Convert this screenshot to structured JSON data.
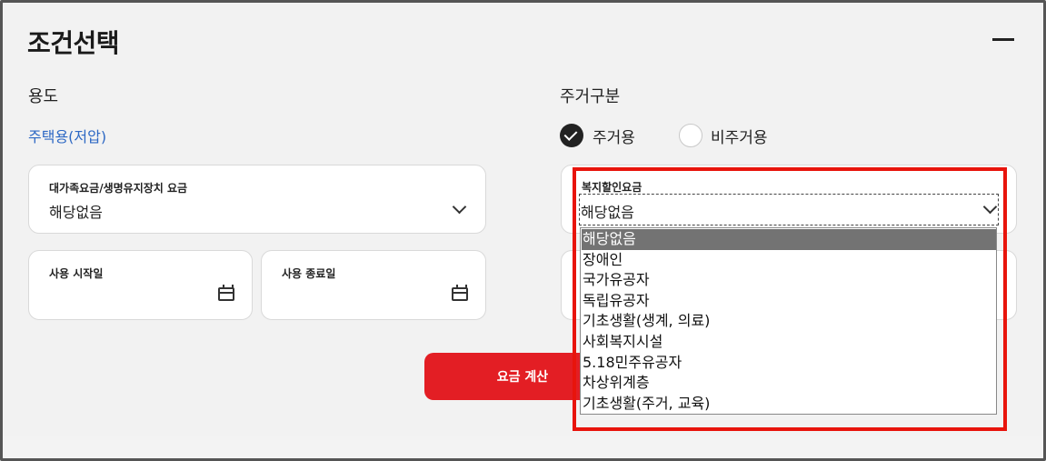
{
  "header": {
    "title": "조건선택"
  },
  "usage": {
    "label": "용도",
    "value": "주택용(저압)"
  },
  "large_family": {
    "caption": "대가족요금/생명유지장치 요금",
    "value": "해당없음"
  },
  "dates": {
    "start_label": "사용 시작일",
    "end_label": "사용 종료일"
  },
  "residence": {
    "label": "주거구분",
    "options": [
      {
        "label": "주거용",
        "checked": true
      },
      {
        "label": "비주거용",
        "checked": false
      }
    ]
  },
  "welfare": {
    "caption": "복지할인요금",
    "value": "해당없음",
    "options": [
      "해당없음",
      "장애인",
      "국가유공자",
      "독립유공자",
      "기초생활(생계, 의료)",
      "사회복지시설",
      "5.18민주유공자",
      "차상위계층",
      "기초생활(주거, 교육)"
    ],
    "selected_index": 0
  },
  "calc_button": {
    "label": "요금 계산"
  },
  "colors": {
    "accent_red": "#e31e24",
    "link_blue": "#2d68c4",
    "highlight_box": "#e8140c"
  }
}
